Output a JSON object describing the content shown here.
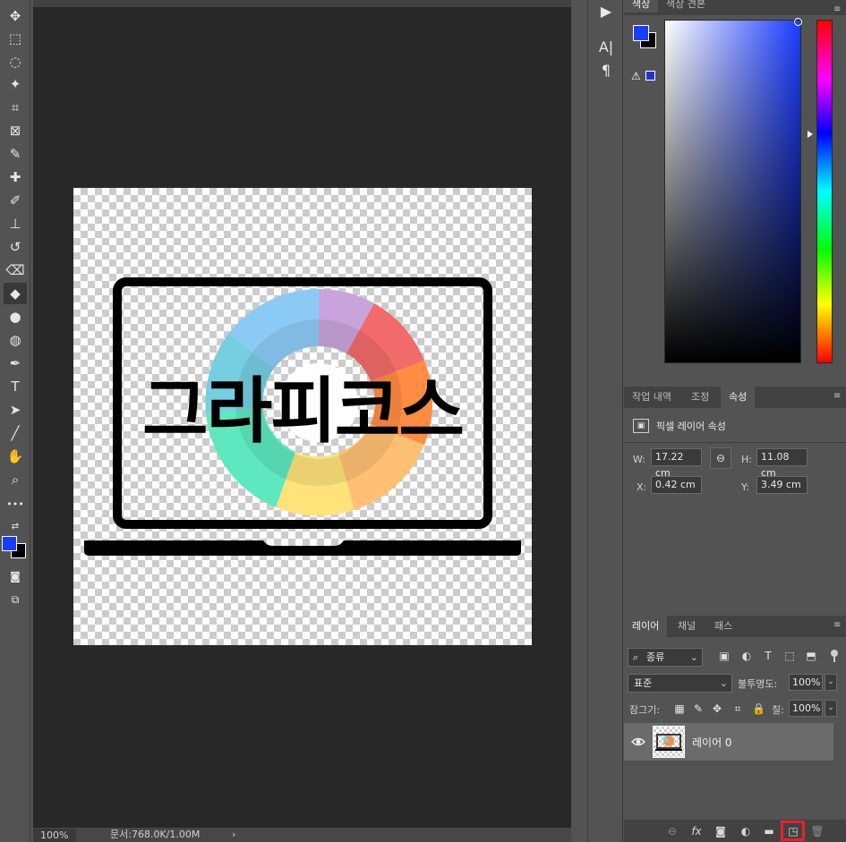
{
  "toolbar": {
    "tools": [
      {
        "name": "move-icon",
        "glyph": "✥"
      },
      {
        "name": "marquee-icon",
        "glyph": "⬚"
      },
      {
        "name": "lasso-icon",
        "glyph": "◌"
      },
      {
        "name": "magic-wand-icon",
        "glyph": "✦"
      },
      {
        "name": "crop-icon",
        "glyph": "⌗"
      },
      {
        "name": "frame-icon",
        "glyph": "⊠"
      },
      {
        "name": "eyedropper-icon",
        "glyph": "✎"
      },
      {
        "name": "healing-brush-icon",
        "glyph": "✚"
      },
      {
        "name": "brush-icon",
        "glyph": "✐"
      },
      {
        "name": "clone-stamp-icon",
        "glyph": "⊥"
      },
      {
        "name": "history-brush-icon",
        "glyph": "↺"
      },
      {
        "name": "eraser-icon",
        "glyph": "⌫"
      },
      {
        "name": "paint-bucket-icon",
        "glyph": "◆"
      },
      {
        "name": "blur-icon",
        "glyph": "●"
      },
      {
        "name": "dodge-icon",
        "glyph": "◍"
      },
      {
        "name": "pen-icon",
        "glyph": "✒"
      },
      {
        "name": "type-icon",
        "glyph": "T"
      },
      {
        "name": "path-selection-icon",
        "glyph": "➤"
      },
      {
        "name": "line-icon",
        "glyph": "╱"
      },
      {
        "name": "hand-icon",
        "glyph": "✋"
      },
      {
        "name": "zoom-icon",
        "glyph": "⌕"
      },
      {
        "name": "more-tools-icon",
        "glyph": "•••"
      }
    ]
  },
  "canvas": {
    "logo_text": "그라피코스"
  },
  "status": {
    "zoom": "100%",
    "doc_info": "문서:768.0K/1.00M",
    "arrow": "›"
  },
  "dock": {
    "play": "▶",
    "character": "A|",
    "paragraph": "¶"
  },
  "color_panel": {
    "tabs": [
      "색상",
      "색상 견본"
    ],
    "foreground": "#1a3cff",
    "background": "#000000"
  },
  "props_panel": {
    "tabs": [
      "작업 내역",
      "조정",
      "속성"
    ],
    "header": "픽셀 레이어 속성",
    "w_label": "W:",
    "w_value": "17.22 cm",
    "h_label": "H:",
    "h_value": "11.08 cm",
    "x_label": "X:",
    "x_value": "0.42 cm",
    "y_label": "Y:",
    "y_value": "3.49 cm"
  },
  "layers_panel": {
    "tabs": [
      "레이어",
      "채널",
      "패스"
    ],
    "filter_label": "종류",
    "blend_mode": "표준",
    "opacity_label": "불투명도:",
    "opacity_value": "100%",
    "lock_label": "잠그기:",
    "fill_label": "칠:",
    "fill_value": "100%",
    "layer_name": "레이어 0"
  }
}
